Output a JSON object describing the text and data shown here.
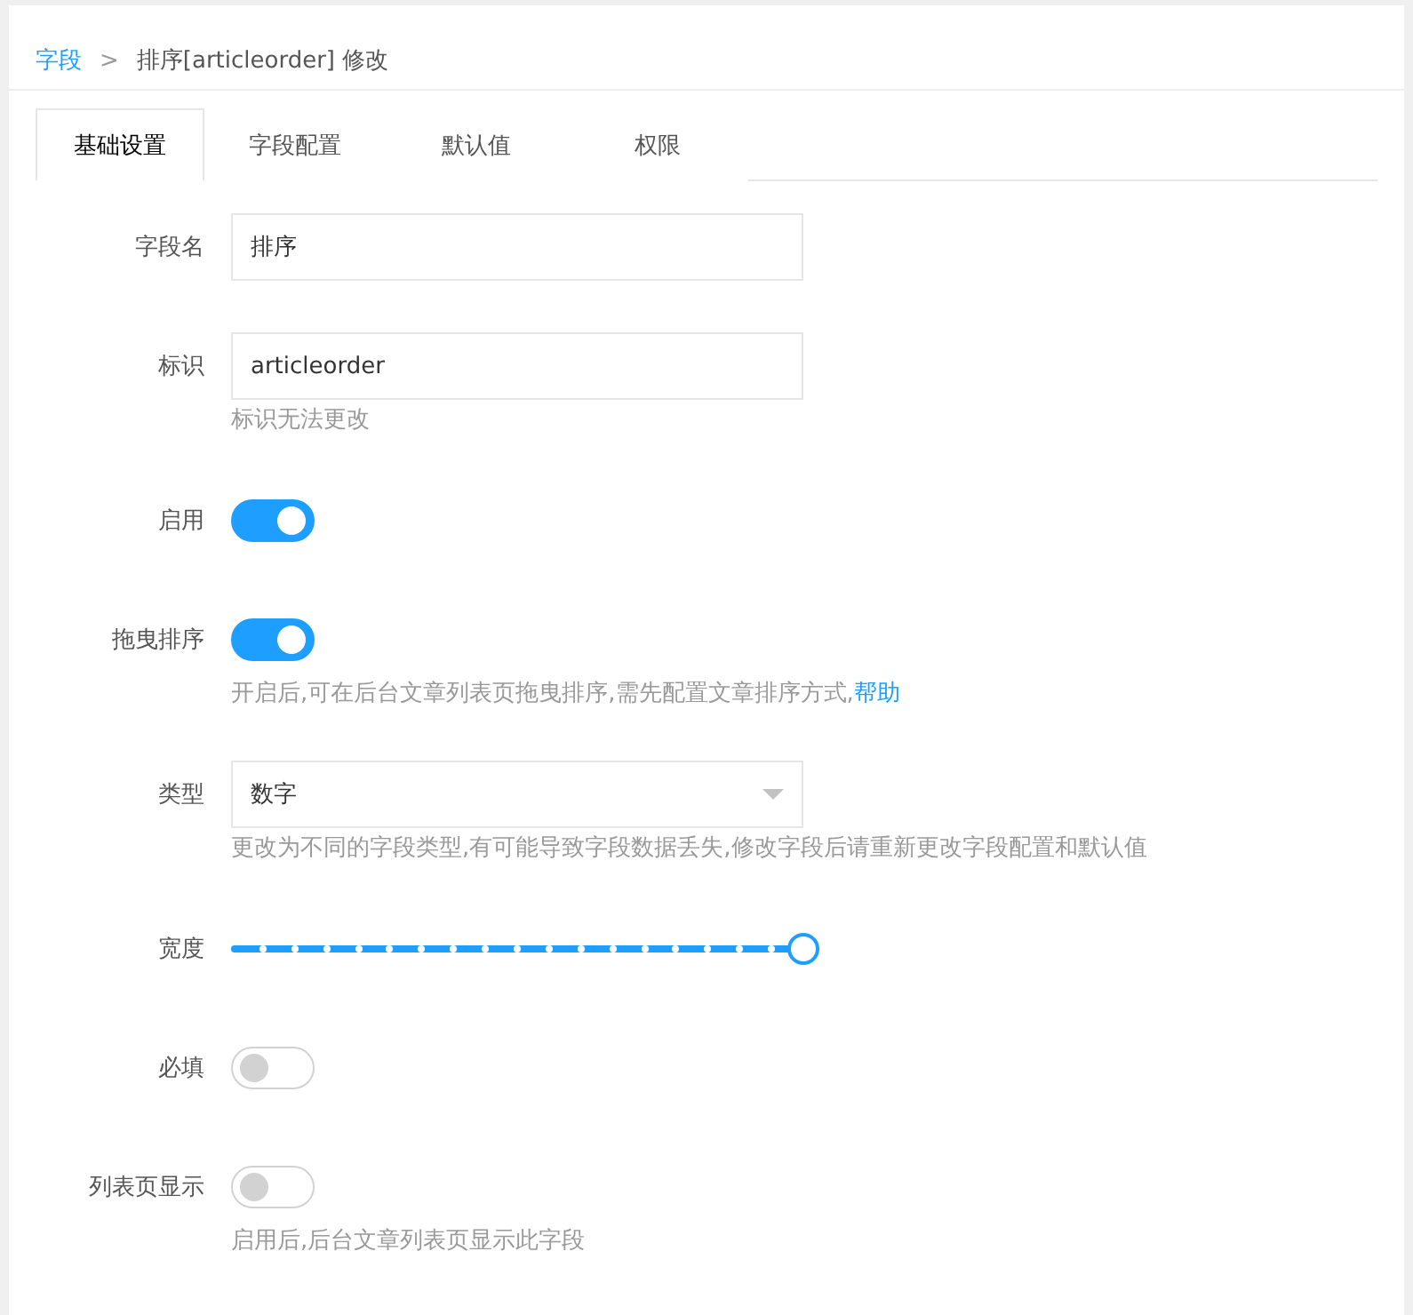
{
  "breadcrumb": {
    "parent": "字段",
    "separator": ">",
    "current": "排序[articleorder] 修改"
  },
  "tabs": [
    {
      "label": "基础设置",
      "selected": true
    },
    {
      "label": "字段配置",
      "selected": false
    },
    {
      "label": "默认值",
      "selected": false
    },
    {
      "label": "权限",
      "selected": false
    }
  ],
  "form": [
    {
      "kind": "input",
      "label": "字段名",
      "value": "排序"
    },
    {
      "kind": "input",
      "label": "标识",
      "value": "articleorder",
      "hint": "标识无法更改"
    },
    {
      "kind": "switch",
      "label": "启用",
      "on": true
    },
    {
      "kind": "switch",
      "label": "拖曳排序",
      "on": true,
      "hint": "开启后,可在后台文章列表页拖曳排序,需先配置文章排序方式,",
      "link": "帮助"
    },
    {
      "kind": "select",
      "label": "类型",
      "value": "数字",
      "hint": "更改为不同的字段类型,有可能导致字段数据丢失,修改字段后请重新更改字段配置和默认值"
    },
    {
      "kind": "slider",
      "label": "宽度",
      "level": 1
    },
    {
      "kind": "switch",
      "label": "必填",
      "on": false
    },
    {
      "kind": "switch",
      "label": "列表页显示",
      "on": false,
      "hint": "启用后,后台文章列表页显示此字段"
    }
  ]
}
